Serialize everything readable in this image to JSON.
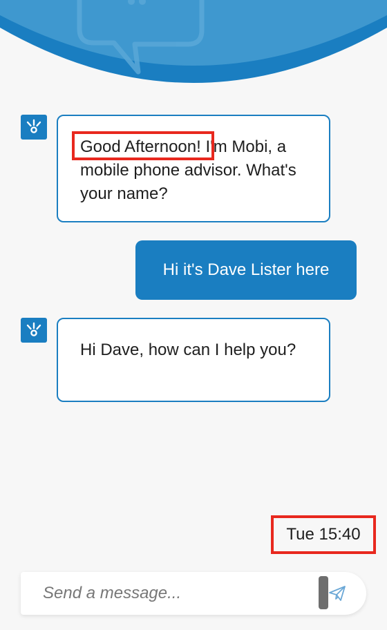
{
  "colors": {
    "brand": "#1a7ec1",
    "header_light": "#3f98cf",
    "highlight": "#e8281e",
    "background": "#f7f7f7"
  },
  "header": {
    "icon": "chat-bubble-icon"
  },
  "messages": [
    {
      "sender": "bot",
      "avatar_icon": "bot-avatar-icon",
      "highlight": "Good Afternoon!",
      "text_rest": " I'm Mobi, a mobile phone advisor. What's your name?"
    },
    {
      "sender": "user",
      "text": "Hi it's Dave Lister here"
    },
    {
      "sender": "bot",
      "avatar_icon": "bot-avatar-icon",
      "text": "Hi Dave, how can I help you?"
    }
  ],
  "timestamp": "Tue 15:40",
  "composer": {
    "placeholder": "Send a message...",
    "value": "",
    "send_icon": "paper-plane-icon"
  }
}
